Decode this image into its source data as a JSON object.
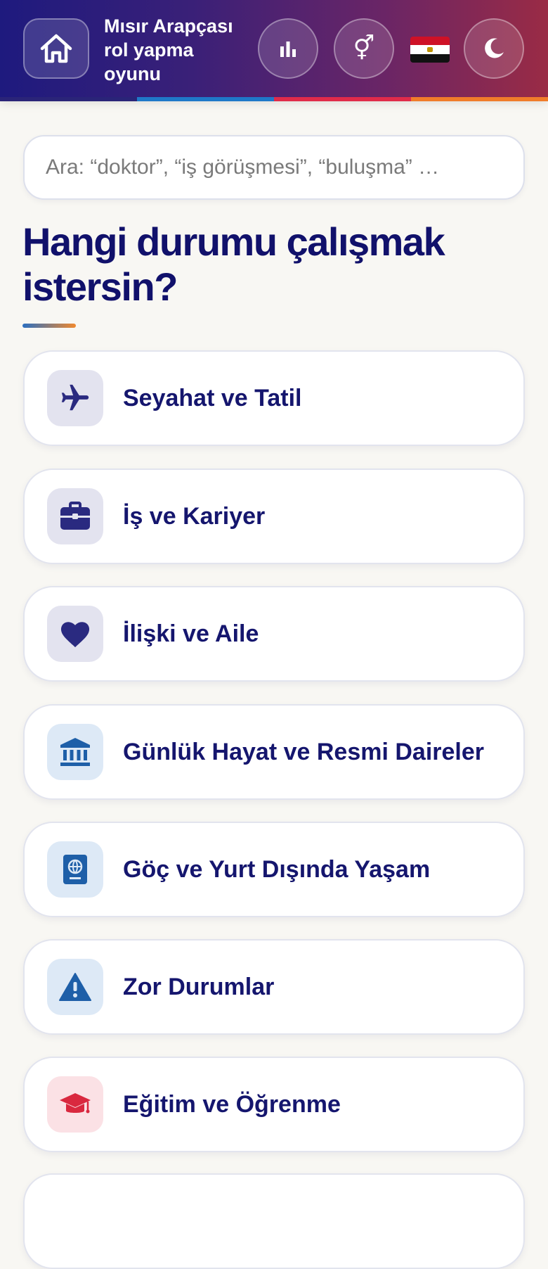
{
  "header": {
    "title": "Mısır Arapçası rol yapma oyunu",
    "home_icon": "home-icon",
    "stats_icon": "bar-chart-icon",
    "gender_symbol": "⚥",
    "flag": "egypt-flag",
    "theme_icon": "moon-icon",
    "colors": {
      "gradient_start": "#1e1a7e",
      "gradient_end": "#9a2b45",
      "stripe": [
        "#2a2478",
        "#1f78c8",
        "#e02b4a",
        "#f07c2a"
      ]
    }
  },
  "search": {
    "placeholder": "Ara: “doktor”, “iş görüşmesi”, “buluşma” …",
    "value": ""
  },
  "heading": "Hangi durumu çalışmak istersin?",
  "categories": [
    {
      "label": "Seyahat ve Tatil",
      "icon": "airplane-icon"
    },
    {
      "label": "İş ve Kariyer",
      "icon": "briefcase-icon"
    },
    {
      "label": "İlişki ve Aile",
      "icon": "heart-icon"
    },
    {
      "label": "Günlük Hayat ve Resmi Daireler",
      "icon": "bank-icon"
    },
    {
      "label": "Göç ve Yurt Dışında Yaşam",
      "icon": "passport-icon"
    },
    {
      "label": "Zor Durumlar",
      "icon": "warning-icon"
    },
    {
      "label": "Eğitim ve Öğrenme",
      "icon": "graduation-cap-icon"
    }
  ]
}
